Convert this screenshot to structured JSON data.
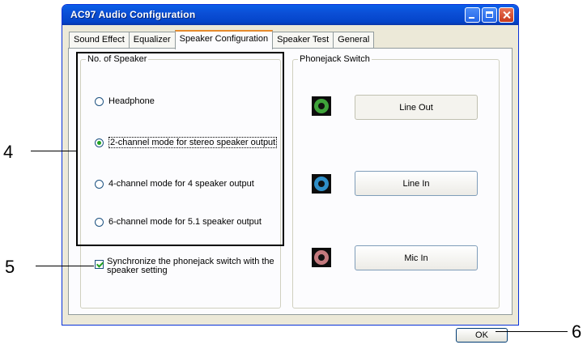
{
  "window": {
    "title": "AC97 Audio Configuration"
  },
  "tabs": [
    {
      "label": "Sound Effect"
    },
    {
      "label": "Equalizer"
    },
    {
      "label": "Speaker Configuration"
    },
    {
      "label": "Speaker Test"
    },
    {
      "label": "General"
    }
  ],
  "speaker_group": {
    "title": "No. of Speaker",
    "options": [
      {
        "label": "Headphone",
        "selected": false
      },
      {
        "label": "2-channel mode for stereo speaker output",
        "selected": true
      },
      {
        "label": "4-channel mode for 4 speaker output",
        "selected": false
      },
      {
        "label": "6-channel mode for 5.1 speaker output",
        "selected": false
      }
    ],
    "sync_checkbox": {
      "label": "Synchronize the phonejack switch with the speaker setting",
      "checked": true
    }
  },
  "phonejack_group": {
    "title": "Phonejack Switch",
    "jacks": [
      {
        "label": "Line Out",
        "color": "#3fa33a",
        "enabled": false
      },
      {
        "label": "Line In",
        "color": "#2f8fc8",
        "enabled": true
      },
      {
        "label": "Mic In",
        "color": "#c47a7e",
        "enabled": true
      }
    ]
  },
  "ok_label": "OK",
  "callouts": [
    "4",
    "5",
    "6"
  ]
}
